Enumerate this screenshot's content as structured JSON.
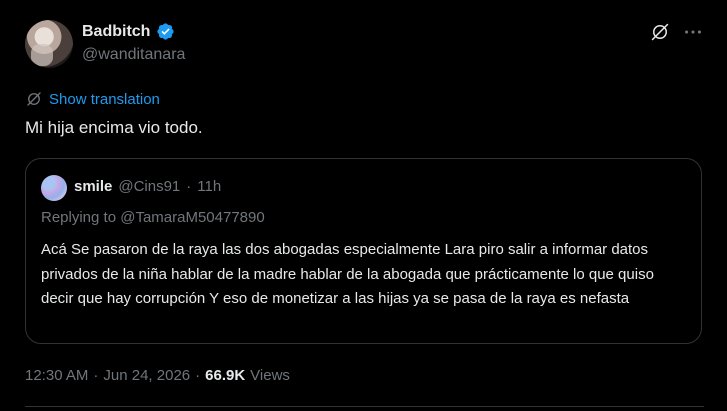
{
  "author": {
    "display_name": "Badbitch",
    "handle": "@wanditanara",
    "verified": true
  },
  "actions": {
    "grok_icon": "grok-icon",
    "more_icon": "more-icon"
  },
  "translation": {
    "label": "Show translation"
  },
  "tweet": {
    "text": "Mi hija encima vio todo."
  },
  "quote": {
    "display_name": "smile",
    "handle": "@Cins91",
    "separator": "·",
    "time": "11h",
    "replying_to": "Replying to @TamaraM50477890",
    "body": "Acá Se pasaron de la raya las dos abogadas especialmente Lara piro salir a informar datos privados de la niña hablar de la madre hablar de la abogada que prácticamente lo que quiso decir que hay corrupción Y eso de monetizar a las hijas ya se pasa de la raya es nefasta"
  },
  "footer": {
    "time": "12:30 AM",
    "date": "Jun 24, 2026",
    "separator": "·",
    "views_count": "66.9K",
    "views_label": "Views"
  },
  "colors": {
    "background": "#000000",
    "text": "#e7e9ea",
    "secondary": "#71767b",
    "accent": "#1d9bf0",
    "border": "#2f3336"
  }
}
